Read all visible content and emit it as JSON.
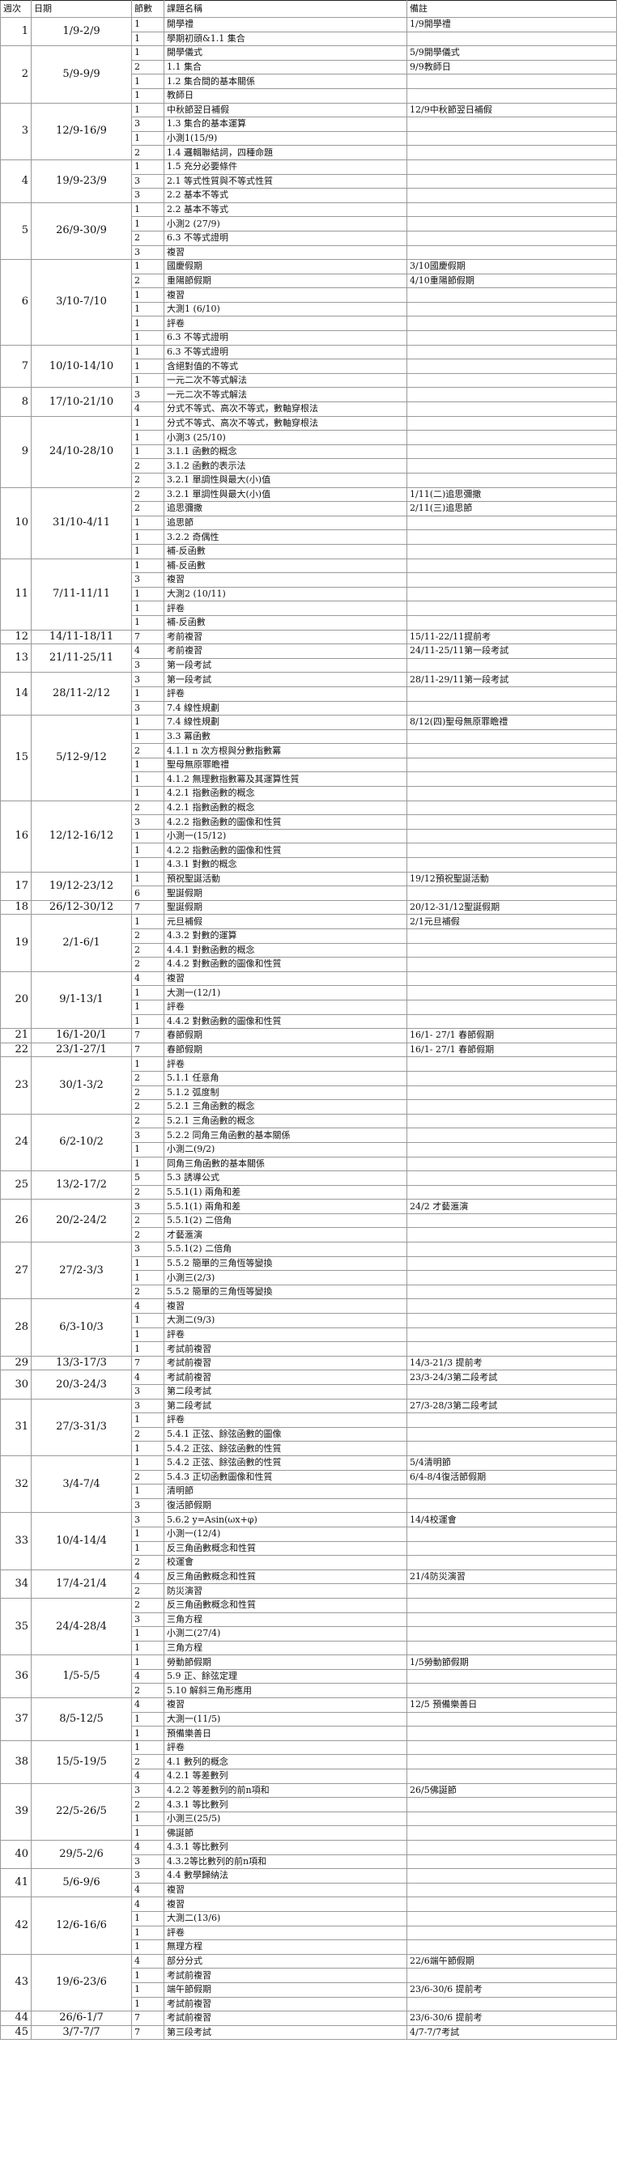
{
  "header": {
    "week": "週次",
    "date": "日期",
    "sessions": "節數",
    "topic": "課題名稱",
    "remarks": "備註"
  },
  "rows": [
    {
      "w": "1",
      "d": "1/9-2/9",
      "n": "1",
      "t": "開學禮",
      "r": "1/9開學禮"
    },
    {
      "w": "",
      "d": "",
      "n": "1",
      "t": "學期初頭&1.1 集合",
      "r": ""
    },
    {
      "w": "2",
      "d": "5/9-9/9",
      "n": "1",
      "t": "開學儀式",
      "r": "5/9開學儀式"
    },
    {
      "w": "",
      "d": "",
      "n": "2",
      "t": "1.1 集合",
      "r": "9/9教師日"
    },
    {
      "w": "",
      "d": "",
      "n": "1",
      "t": "1.2 集合間的基本關係",
      "r": ""
    },
    {
      "w": "",
      "d": "",
      "n": "1",
      "t": "教師日",
      "r": ""
    },
    {
      "w": "3",
      "d": "12/9-16/9",
      "n": "1",
      "t": "中秋節翌日補假",
      "r": "12/9中秋節翌日補假"
    },
    {
      "w": "",
      "d": "",
      "n": "3",
      "t": "1.3 集合的基本運算",
      "r": ""
    },
    {
      "w": "",
      "d": "",
      "n": "1",
      "t": "小測1(15/9)",
      "r": ""
    },
    {
      "w": "",
      "d": "",
      "n": "2",
      "t": "1.4 邏輯聯結詞，四種命題",
      "r": ""
    },
    {
      "w": "4",
      "d": "19/9-23/9",
      "n": "1",
      "t": "1.5 充分必要條件",
      "r": ""
    },
    {
      "w": "",
      "d": "",
      "n": "3",
      "t": "2.1 等式性質與不等式性質",
      "r": ""
    },
    {
      "w": "",
      "d": "",
      "n": "3",
      "t": "2.2 基本不等式",
      "r": ""
    },
    {
      "w": "5",
      "d": "26/9-30/9",
      "n": "1",
      "t": "2.2 基本不等式",
      "r": ""
    },
    {
      "w": "",
      "d": "",
      "n": "1",
      "t": "小測2 (27/9)",
      "r": ""
    },
    {
      "w": "",
      "d": "",
      "n": "2",
      "t": "6.3 不等式證明",
      "r": ""
    },
    {
      "w": "",
      "d": "",
      "n": "3",
      "t": "複習",
      "r": ""
    },
    {
      "w": "6",
      "d": "3/10-7/10",
      "n": "1",
      "t": "國慶假期",
      "r": "3/10國慶假期"
    },
    {
      "w": "",
      "d": "",
      "n": "2",
      "t": "重陽節假期",
      "r": "4/10重陽節假期"
    },
    {
      "w": "",
      "d": "",
      "n": "1",
      "t": "複習",
      "r": ""
    },
    {
      "w": "",
      "d": "",
      "n": "1",
      "t": "大測1 (6/10)",
      "r": ""
    },
    {
      "w": "",
      "d": "",
      "n": "1",
      "t": "評卷",
      "r": ""
    },
    {
      "w": "",
      "d": "",
      "n": "1",
      "t": "6.3 不等式證明",
      "r": ""
    },
    {
      "w": "7",
      "d": "10/10-14/10",
      "n": "1",
      "t": "6.3 不等式證明",
      "r": ""
    },
    {
      "w": "",
      "d": "",
      "n": "1",
      "t": "含絕對值的不等式",
      "r": ""
    },
    {
      "w": "",
      "d": "",
      "n": "1",
      "t": "一元二次不等式解法",
      "r": ""
    },
    {
      "w": "8",
      "d": "17/10-21/10",
      "n": "3",
      "t": "一元二次不等式解法",
      "r": ""
    },
    {
      "w": "",
      "d": "",
      "n": "4",
      "t": "分式不等式、高次不等式，數軸穿根法",
      "r": ""
    },
    {
      "w": "9",
      "d": "24/10-28/10",
      "n": "1",
      "t": "分式不等式、高次不等式，數軸穿根法",
      "r": ""
    },
    {
      "w": "",
      "d": "",
      "n": "1",
      "t": "小測3 (25/10)",
      "r": ""
    },
    {
      "w": "",
      "d": "",
      "n": "1",
      "t": "3.1.1 函數的概念",
      "r": ""
    },
    {
      "w": "",
      "d": "",
      "n": "2",
      "t": "3.1.2 函數的表示法",
      "r": ""
    },
    {
      "w": "",
      "d": "",
      "n": "2",
      "t": "3.2.1 單調性與最大(小)值",
      "r": ""
    },
    {
      "w": "10",
      "d": "31/10-4/11",
      "n": "2",
      "t": "3.2.1 單調性與最大(小)值",
      "r": "1/11(二)追思彌撒"
    },
    {
      "w": "",
      "d": "",
      "n": "2",
      "t": "追思彌撒",
      "r": "2/11(三)追思節"
    },
    {
      "w": "",
      "d": "",
      "n": "1",
      "t": "追思節",
      "r": ""
    },
    {
      "w": "",
      "d": "",
      "n": "1",
      "t": "3.2.2 奇偶性",
      "r": ""
    },
    {
      "w": "",
      "d": "",
      "n": "1",
      "t": "補-反函數",
      "r": ""
    },
    {
      "w": "11",
      "d": "7/11-11/11",
      "n": "1",
      "t": "補-反函數",
      "r": ""
    },
    {
      "w": "",
      "d": "",
      "n": "3",
      "t": "複習",
      "r": ""
    },
    {
      "w": "",
      "d": "",
      "n": "1",
      "t": "大測2 (10/11)",
      "r": ""
    },
    {
      "w": "",
      "d": "",
      "n": "1",
      "t": "評卷",
      "r": ""
    },
    {
      "w": "",
      "d": "",
      "n": "1",
      "t": "補-反函數",
      "r": ""
    },
    {
      "w": "12",
      "d": "14/11-18/11",
      "n": "7",
      "t": "考前複習",
      "r": "15/11-22/11提前考"
    },
    {
      "w": "13",
      "d": "21/11-25/11",
      "n": "4",
      "t": "考前複習",
      "r": "24/11-25/11第一段考試"
    },
    {
      "w": "",
      "d": "",
      "n": "3",
      "t": "第一段考試",
      "r": ""
    },
    {
      "w": "14",
      "d": "28/11-2/12",
      "n": "3",
      "t": "第一段考試",
      "r": "28/11-29/11第一段考試"
    },
    {
      "w": "",
      "d": "",
      "n": "1",
      "t": "評卷",
      "r": ""
    },
    {
      "w": "",
      "d": "",
      "n": "3",
      "t": "7.4 線性規劃",
      "r": ""
    },
    {
      "w": "15",
      "d": "5/12-9/12",
      "n": "1",
      "t": "7.4 線性規劃",
      "r": "8/12(四)聖母無原罪瞻禮"
    },
    {
      "w": "",
      "d": "",
      "n": "1",
      "t": "3.3 冪函數",
      "r": ""
    },
    {
      "w": "",
      "d": "",
      "n": "2",
      "t": "4.1.1 n 次方根與分數指數冪",
      "r": ""
    },
    {
      "w": "",
      "d": "",
      "n": "1",
      "t": "聖母無原罪瞻禮",
      "r": ""
    },
    {
      "w": "",
      "d": "",
      "n": "1",
      "t": "4.1.2 無理數指數冪及其運算性質",
      "r": ""
    },
    {
      "w": "",
      "d": "",
      "n": "1",
      "t": "4.2.1 指數函數的概念",
      "r": ""
    },
    {
      "w": "16",
      "d": "12/12-16/12",
      "n": "2",
      "t": "4.2.1 指數函數的概念",
      "r": ""
    },
    {
      "w": "",
      "d": "",
      "n": "3",
      "t": "4.2.2 指數函數的圖像和性質",
      "r": ""
    },
    {
      "w": "",
      "d": "",
      "n": "1",
      "t": "小測一(15/12)",
      "r": ""
    },
    {
      "w": "",
      "d": "",
      "n": "1",
      "t": "4.2.2 指數函數的圖像和性質",
      "r": ""
    },
    {
      "w": "",
      "d": "",
      "n": "1",
      "t": "4.3.1 對數的概念",
      "r": ""
    },
    {
      "w": "17",
      "d": "19/12-23/12",
      "n": "1",
      "t": "預祝聖誕活動",
      "r": "19/12預祝聖誕活動"
    },
    {
      "w": "",
      "d": "",
      "n": "6",
      "t": "聖誕假期",
      "r": ""
    },
    {
      "w": "18",
      "d": "26/12-30/12",
      "n": "7",
      "t": "聖誕假期",
      "r": "20/12-31/12聖誕假期"
    },
    {
      "w": "19",
      "d": "2/1-6/1",
      "n": "1",
      "t": "元旦補假",
      "r": "2/1元旦補假"
    },
    {
      "w": "",
      "d": "",
      "n": "2",
      "t": "4.3.2 對數的運算",
      "r": ""
    },
    {
      "w": "",
      "d": "",
      "n": "2",
      "t": "4.4.1 對數函數的概念",
      "r": ""
    },
    {
      "w": "",
      "d": "",
      "n": "2",
      "t": "4.4.2 對數函數的圖像和性質",
      "r": ""
    },
    {
      "w": "20",
      "d": "9/1-13/1",
      "n": "4",
      "t": "複習",
      "r": ""
    },
    {
      "w": "",
      "d": "",
      "n": "1",
      "t": "大測一(12/1)",
      "r": ""
    },
    {
      "w": "",
      "d": "",
      "n": "1",
      "t": "評卷",
      "r": ""
    },
    {
      "w": "",
      "d": "",
      "n": "1",
      "t": "4.4.2 對數函數的圖像和性質",
      "r": ""
    },
    {
      "w": "21",
      "d": "16/1-20/1",
      "n": "7",
      "t": "春節假期",
      "r": "16/1- 27/1 春節假期"
    },
    {
      "w": "22",
      "d": "23/1-27/1",
      "n": "7",
      "t": "春節假期",
      "r": "16/1- 27/1 春節假期"
    },
    {
      "w": "23",
      "d": "30/1-3/2",
      "n": "1",
      "t": "評卷",
      "r": ""
    },
    {
      "w": "",
      "d": "",
      "n": "2",
      "t": "5.1.1 任意角",
      "r": ""
    },
    {
      "w": "",
      "d": "",
      "n": "2",
      "t": "5.1.2 弧度制",
      "r": ""
    },
    {
      "w": "",
      "d": "",
      "n": "2",
      "t": "5.2.1 三角函數的概念",
      "r": ""
    },
    {
      "w": "24",
      "d": "6/2-10/2",
      "n": "2",
      "t": "5.2.1 三角函數的概念",
      "r": ""
    },
    {
      "w": "",
      "d": "",
      "n": "3",
      "t": "5.2.2 同角三角函數的基本關係",
      "r": ""
    },
    {
      "w": "",
      "d": "",
      "n": "1",
      "t": "小測二(9/2)",
      "r": ""
    },
    {
      "w": "",
      "d": "",
      "n": "1",
      "t": "同角三角函數的基本關係",
      "r": ""
    },
    {
      "w": "25",
      "d": "13/2-17/2",
      "n": "5",
      "t": "5.3 誘導公式",
      "r": ""
    },
    {
      "w": "",
      "d": "",
      "n": "2",
      "t": "5.5.1(1) 兩角和差",
      "r": ""
    },
    {
      "w": "26",
      "d": "20/2-24/2",
      "n": "3",
      "t": "5.5.1(1) 兩角和差",
      "r": "24/2 才藝滙演"
    },
    {
      "w": "",
      "d": "",
      "n": "2",
      "t": "5.5.1(2) 二倍角",
      "r": ""
    },
    {
      "w": "",
      "d": "",
      "n": "2",
      "t": "才藝滙演",
      "r": ""
    },
    {
      "w": "27",
      "d": "27/2-3/3",
      "n": "3",
      "t": "5.5.1(2) 二倍角",
      "r": ""
    },
    {
      "w": "",
      "d": "",
      "n": "1",
      "t": "5.5.2 簡單的三角恆等變換",
      "r": ""
    },
    {
      "w": "",
      "d": "",
      "n": "1",
      "t": "小測三(2/3)",
      "r": ""
    },
    {
      "w": "",
      "d": "",
      "n": "2",
      "t": "5.5.2 簡單的三角恆等變換",
      "r": ""
    },
    {
      "w": "28",
      "d": "6/3-10/3",
      "n": "4",
      "t": "複習",
      "r": ""
    },
    {
      "w": "",
      "d": "",
      "n": "1",
      "t": "大測二(9/3)",
      "r": ""
    },
    {
      "w": "",
      "d": "",
      "n": "1",
      "t": "評卷",
      "r": ""
    },
    {
      "w": "",
      "d": "",
      "n": "1",
      "t": "考試前複習",
      "r": ""
    },
    {
      "w": "29",
      "d": "13/3-17/3",
      "n": "7",
      "t": "考試前複習",
      "r": "14/3-21/3 提前考"
    },
    {
      "w": "30",
      "d": "20/3-24/3",
      "n": "4",
      "t": "考試前複習",
      "r": "23/3-24/3第二段考試"
    },
    {
      "w": "",
      "d": "",
      "n": "3",
      "t": "第二段考試",
      "r": ""
    },
    {
      "w": "31",
      "d": "27/3-31/3",
      "n": "3",
      "t": "第二段考試",
      "r": "27/3-28/3第二段考試"
    },
    {
      "w": "",
      "d": "",
      "n": "1",
      "t": "評卷",
      "r": ""
    },
    {
      "w": "",
      "d": "",
      "n": "2",
      "t": "5.4.1 正弦、餘弦函數的圖像",
      "r": ""
    },
    {
      "w": "",
      "d": "",
      "n": "1",
      "t": "5.4.2 正弦、餘弦函數的性質",
      "r": ""
    },
    {
      "w": "32",
      "d": "3/4-7/4",
      "n": "1",
      "t": "5.4.2 正弦、餘弦函數的性質",
      "r": "5/4清明節"
    },
    {
      "w": "",
      "d": "",
      "n": "2",
      "t": "5.4.3 正切函數圖像和性質",
      "r": "6/4-8/4復活節假期"
    },
    {
      "w": "",
      "d": "",
      "n": "1",
      "t": "清明節",
      "r": ""
    },
    {
      "w": "",
      "d": "",
      "n": "3",
      "t": "復活節假期",
      "r": ""
    },
    {
      "w": "33",
      "d": "10/4-14/4",
      "n": "3",
      "t": "5.6.2 y=Asin(ωx+φ)",
      "r": "14/4校運會"
    },
    {
      "w": "",
      "d": "",
      "n": "1",
      "t": "小測一(12/4)",
      "r": ""
    },
    {
      "w": "",
      "d": "",
      "n": "1",
      "t": "反三角函數概念和性質",
      "r": ""
    },
    {
      "w": "",
      "d": "",
      "n": "2",
      "t": "校運會",
      "r": ""
    },
    {
      "w": "34",
      "d": "17/4-21/4",
      "n": "4",
      "t": "反三角函數概念和性質",
      "r": "21/4防災演習"
    },
    {
      "w": "",
      "d": "",
      "n": "2",
      "t": "防災演習",
      "r": ""
    },
    {
      "w": "35",
      "d": "24/4-28/4",
      "n": "2",
      "t": "反三角函數概念和性質",
      "r": ""
    },
    {
      "w": "",
      "d": "",
      "n": "3",
      "t": "三角方程",
      "r": ""
    },
    {
      "w": "",
      "d": "",
      "n": "1",
      "t": "小測二(27/4)",
      "r": ""
    },
    {
      "w": "",
      "d": "",
      "n": "1",
      "t": "三角方程",
      "r": ""
    },
    {
      "w": "36",
      "d": "1/5-5/5",
      "n": "1",
      "t": "勞動節假期",
      "r": "1/5勞動節假期"
    },
    {
      "w": "",
      "d": "",
      "n": "4",
      "t": "5.9 正、餘弦定理",
      "r": ""
    },
    {
      "w": "",
      "d": "",
      "n": "2",
      "t": "5.10 解斜三角形應用",
      "r": ""
    },
    {
      "w": "37",
      "d": "8/5-12/5",
      "n": "4",
      "t": "複習",
      "r": "12/5 預備樂善日"
    },
    {
      "w": "",
      "d": "",
      "n": "1",
      "t": "大測一(11/5)",
      "r": ""
    },
    {
      "w": "",
      "d": "",
      "n": "1",
      "t": "預備樂善日",
      "r": ""
    },
    {
      "w": "38",
      "d": "15/5-19/5",
      "n": "1",
      "t": "評卷",
      "r": ""
    },
    {
      "w": "",
      "d": "",
      "n": "2",
      "t": "4.1 數列的概念",
      "r": ""
    },
    {
      "w": "",
      "d": "",
      "n": "4",
      "t": "4.2.1 等差數列",
      "r": ""
    },
    {
      "w": "39",
      "d": "22/5-26/5",
      "n": "3",
      "t": "4.2.2 等差數列的前n項和",
      "r": "26/5佛誕節"
    },
    {
      "w": "",
      "d": "",
      "n": "2",
      "t": "4.3.1 等比數列",
      "r": ""
    },
    {
      "w": "",
      "d": "",
      "n": "1",
      "t": "小測三(25/5)",
      "r": ""
    },
    {
      "w": "",
      "d": "",
      "n": "1",
      "t": "佛誕節",
      "r": ""
    },
    {
      "w": "40",
      "d": "29/5-2/6",
      "n": "4",
      "t": "4.3.1 等比數列",
      "r": ""
    },
    {
      "w": "",
      "d": "",
      "n": "3",
      "t": "4.3.2等比數列的前n項和",
      "r": ""
    },
    {
      "w": "41",
      "d": "5/6-9/6",
      "n": "3",
      "t": "4.4 數學歸納法",
      "r": ""
    },
    {
      "w": "",
      "d": "",
      "n": "4",
      "t": "複習",
      "r": ""
    },
    {
      "w": "42",
      "d": "12/6-16/6",
      "n": "4",
      "t": "複習",
      "r": ""
    },
    {
      "w": "",
      "d": "",
      "n": "1",
      "t": "大測二(13/6)",
      "r": ""
    },
    {
      "w": "",
      "d": "",
      "n": "1",
      "t": "評卷",
      "r": ""
    },
    {
      "w": "",
      "d": "",
      "n": "1",
      "t": "無理方程",
      "r": ""
    },
    {
      "w": "43",
      "d": "19/6-23/6",
      "n": "4",
      "t": "部分分式",
      "r": "22/6端午節假期"
    },
    {
      "w": "",
      "d": "",
      "n": "1",
      "t": "考試前複習",
      "r": ""
    },
    {
      "w": "",
      "d": "",
      "n": "1",
      "t": "端午節假期",
      "r": "23/6-30/6 提前考"
    },
    {
      "w": "",
      "d": "",
      "n": "1",
      "t": "考試前複習",
      "r": ""
    },
    {
      "w": "44",
      "d": "26/6-1/7",
      "n": "7",
      "t": "考試前複習",
      "r": "23/6-30/6 提前考"
    },
    {
      "w": "45",
      "d": "3/7-7/7",
      "n": "7",
      "t": "第三段考試",
      "r": "4/7-7/7考試"
    }
  ]
}
